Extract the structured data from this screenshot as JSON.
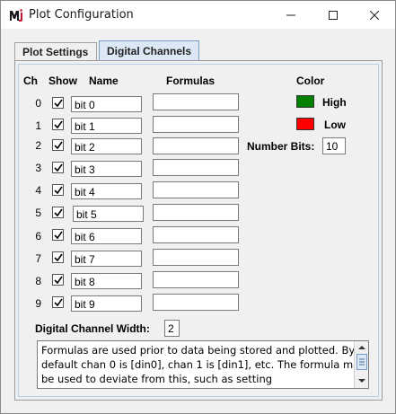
{
  "window": {
    "title": "Plot Configuration"
  },
  "tabs": [
    {
      "label": "Plot Settings"
    },
    {
      "label": "Digital Channels"
    }
  ],
  "headers": {
    "ch": "Ch",
    "show": "Show",
    "name": "Name",
    "formulas": "Formulas",
    "color": "Color"
  },
  "channels": [
    {
      "ch": "0",
      "name": "bit 0",
      "show": true,
      "formula": ""
    },
    {
      "ch": "1",
      "name": "bit 1",
      "show": true,
      "formula": ""
    },
    {
      "ch": "2",
      "name": "bit 2",
      "show": true,
      "formula": ""
    },
    {
      "ch": "3",
      "name": "bit 3",
      "show": true,
      "formula": ""
    },
    {
      "ch": "4",
      "name": "bit 4",
      "show": true,
      "formula": ""
    },
    {
      "ch": "5",
      "name": "bit 5",
      "show": true,
      "formula": ""
    },
    {
      "ch": "6",
      "name": "bit 6",
      "show": true,
      "formula": ""
    },
    {
      "ch": "7",
      "name": "bit 7",
      "show": true,
      "formula": ""
    },
    {
      "ch": "8",
      "name": "bit 8",
      "show": true,
      "formula": ""
    },
    {
      "ch": "9",
      "name": "bit 9",
      "show": true,
      "formula": ""
    }
  ],
  "colors": {
    "high_label": "High",
    "high_color": "#008000",
    "low_label": "Low",
    "low_color": "#ff0000"
  },
  "number_bits": {
    "label": "Number Bits:",
    "value": "10"
  },
  "channel_width": {
    "label": "Digital Channel Width:",
    "value": "2"
  },
  "info_text": "Formulas are used prior to data being stored and plotted. By default chan 0 is [din0], chan 1 is [din1], etc. The formula may be used to deviate from this, such as setting"
}
